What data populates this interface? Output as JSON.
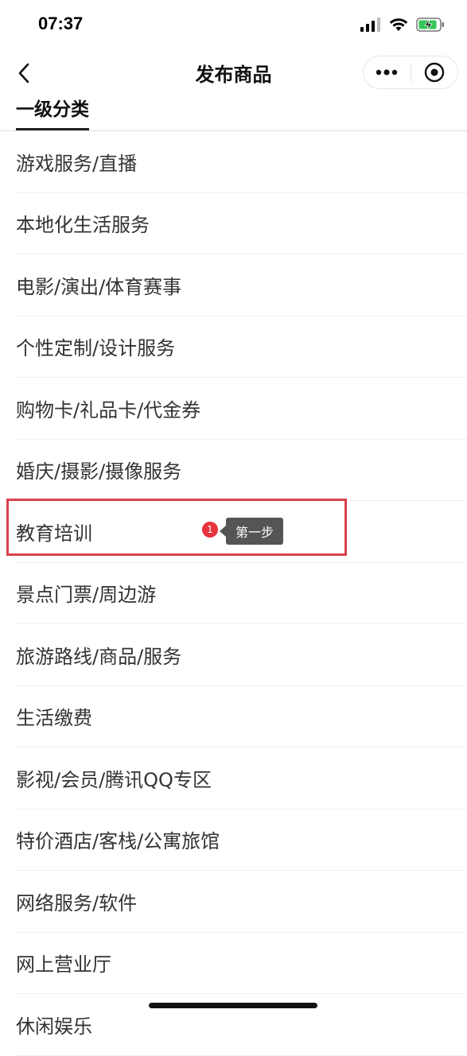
{
  "status_bar": {
    "time": "07:37",
    "icons": [
      "signal-icon",
      "wifi-icon",
      "battery-charging-icon"
    ]
  },
  "nav": {
    "title": "发布商品",
    "back_icon": "chevron-left-icon",
    "more_icon": "more-dots-icon",
    "close_icon": "target-circle-icon"
  },
  "tabs": [
    {
      "label": "一级分类",
      "active": true
    }
  ],
  "categories": [
    {
      "label": "游戏服务/直播"
    },
    {
      "label": "本地化生活服务"
    },
    {
      "label": "电影/演出/体育赛事"
    },
    {
      "label": "个性定制/设计服务"
    },
    {
      "label": "购物卡/礼品卡/代金券"
    },
    {
      "label": "婚庆/摄影/摄像服务"
    },
    {
      "label": "教育培训"
    },
    {
      "label": "景点门票/周边游"
    },
    {
      "label": "旅游路线/商品/服务"
    },
    {
      "label": "生活缴费"
    },
    {
      "label": "影视/会员/腾讯QQ专区"
    },
    {
      "label": "特价酒店/客栈/公寓旅馆"
    },
    {
      "label": "网络服务/软件"
    },
    {
      "label": "网上营业厅"
    },
    {
      "label": "休闲娱乐"
    }
  ],
  "annotation": {
    "step_number": "1",
    "step_label": "第一步",
    "highlight_color": "#d9404a"
  }
}
